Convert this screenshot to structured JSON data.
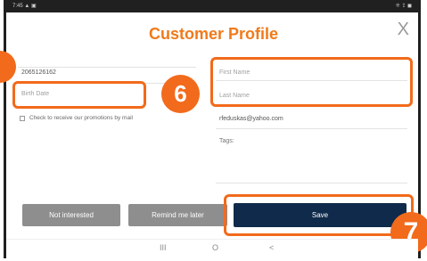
{
  "status_bar": {
    "left": "7:45 ▲ ▣",
    "right": "⁜ ⇪ ◼"
  },
  "header": {
    "title": "Customer Profile",
    "close_label": "X"
  },
  "markers": {
    "left_partial": "",
    "six": "6",
    "seven": "7"
  },
  "left_form": {
    "phone_value": "2065126162",
    "birth_date_placeholder": "Birth Date",
    "promo_checkbox_label": "Check to receive our promotions by mail"
  },
  "right_form": {
    "first_name_placeholder": "First Name",
    "last_name_placeholder": "Last Name",
    "email_value": "rfeduskas@yahoo.com",
    "tags_label": "Tags:"
  },
  "buttons": {
    "not_interested": "Not interested",
    "remind_later": "Remind me later",
    "save": "Save"
  },
  "navbar": {
    "recents": "III",
    "home": "O",
    "back": "<"
  },
  "colors": {
    "accent": "#f07a1a",
    "highlight": "#f26a1b",
    "primary_button": "#0f2a4a",
    "secondary_button": "#8e8e8e"
  }
}
